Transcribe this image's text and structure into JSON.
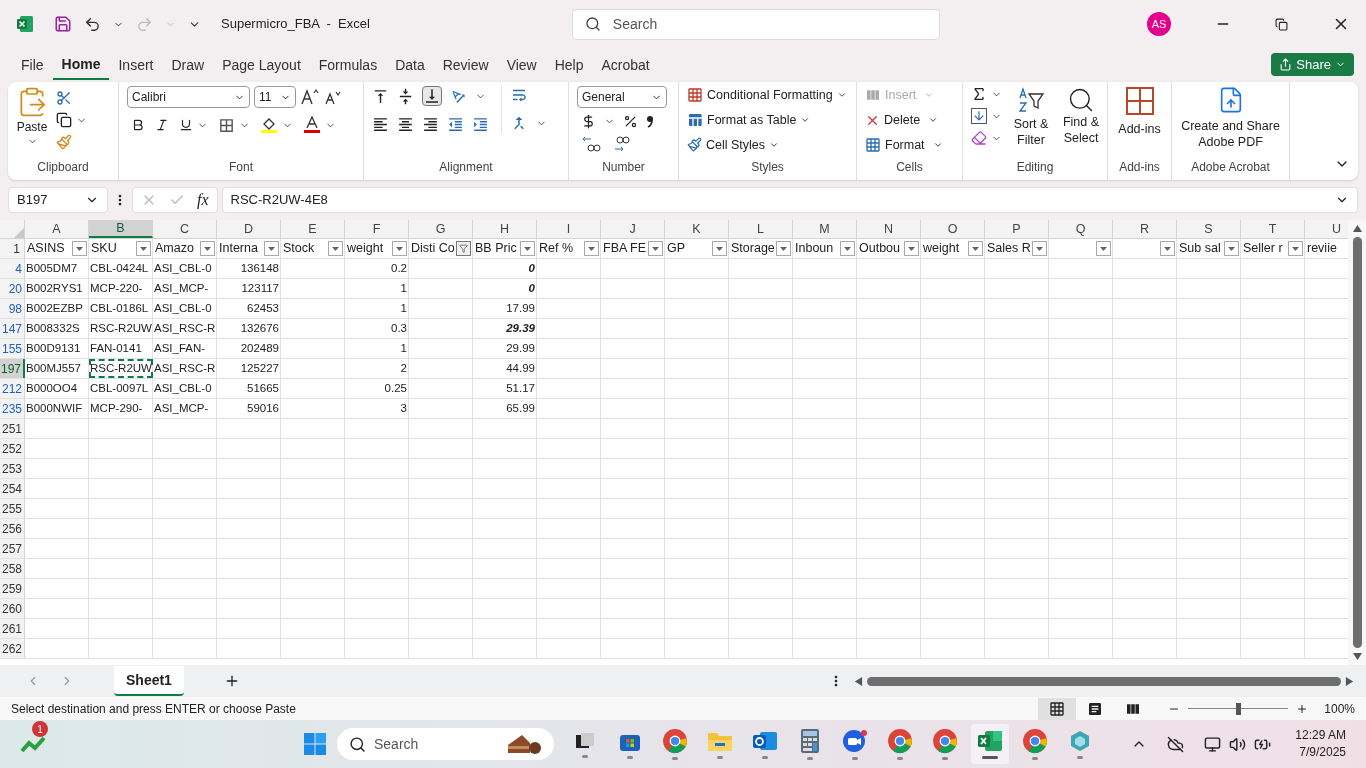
{
  "title_bar": {
    "title": "Supermicro_FBA  -  Excel",
    "search_placeholder": "Search",
    "avatar": "AS"
  },
  "menu_tabs": [
    {
      "label": "File",
      "selected": false
    },
    {
      "label": "Home",
      "selected": true
    },
    {
      "label": "Insert",
      "selected": false
    },
    {
      "label": "Draw",
      "selected": false
    },
    {
      "label": "Page Layout",
      "selected": false
    },
    {
      "label": "Formulas",
      "selected": false
    },
    {
      "label": "Data",
      "selected": false
    },
    {
      "label": "Review",
      "selected": false
    },
    {
      "label": "View",
      "selected": false
    },
    {
      "label": "Help",
      "selected": false
    },
    {
      "label": "Acrobat",
      "selected": false
    }
  ],
  "share_button": "Share",
  "ribbon": {
    "clipboard": {
      "label": "Clipboard",
      "paste": "Paste"
    },
    "font": {
      "label": "Font",
      "name": "Calibri",
      "size": "11"
    },
    "alignment": {
      "label": "Alignment"
    },
    "number": {
      "label": "Number",
      "format": "General"
    },
    "styles": {
      "label": "Styles",
      "items": [
        {
          "kind": "conditional",
          "label": "Conditional Formatting"
        },
        {
          "kind": "table",
          "label": "Format as Table"
        },
        {
          "kind": "cellstyles",
          "label": "Cell Styles"
        }
      ]
    },
    "cells": {
      "label": "Cells",
      "items": [
        {
          "kind": "insert",
          "label": "Insert",
          "disabled": true
        },
        {
          "kind": "delete",
          "label": "Delete",
          "disabled": false
        },
        {
          "kind": "format",
          "label": "Format",
          "disabled": false
        }
      ]
    },
    "editing": {
      "label": "Editing",
      "sort": "Sort & Filter",
      "find": "Find & Select"
    },
    "add_ins": {
      "label": "Add-ins",
      "button": "Add-ins"
    },
    "acrobat": {
      "label": "Adobe Acrobat",
      "button": "Create and Share Adobe PDF"
    }
  },
  "formula_bar": {
    "name_box": "B197",
    "function_symbol": "fx",
    "formula": "RSC-R2UW-4E8"
  },
  "sheet": {
    "header_row_number": "1",
    "columns": [
      {
        "letter": "A",
        "header": "ASINS",
        "kind": "text",
        "filter_button": true,
        "filtered": false,
        "selected": false
      },
      {
        "letter": "B",
        "header": "SKU",
        "kind": "text",
        "filter_button": true,
        "filtered": false,
        "selected": true
      },
      {
        "letter": "C",
        "header": "Amazo",
        "kind": "text",
        "filter_button": true,
        "filtered": false,
        "selected": false
      },
      {
        "letter": "D",
        "header": "Interna",
        "kind": "number",
        "filter_button": true,
        "filtered": false,
        "selected": false
      },
      {
        "letter": "E",
        "header": "Stock",
        "filter_button": true,
        "filtered": false,
        "selected": false
      },
      {
        "letter": "F",
        "header": "weight",
        "kind": "number",
        "filter_button": true,
        "filtered": false,
        "selected": false
      },
      {
        "letter": "G",
        "header": "Disti Co",
        "filter_button": true,
        "filtered": true,
        "selected": false
      },
      {
        "letter": "H",
        "header": "BB Pric",
        "kind": "number",
        "filter_button": true,
        "filtered": false,
        "selected": false
      },
      {
        "letter": "I",
        "header": "Ref %",
        "filter_button": true,
        "filtered": false,
        "selected": false
      },
      {
        "letter": "J",
        "header": "FBA FE",
        "filter_button": true,
        "filtered": false,
        "selected": false
      },
      {
        "letter": "K",
        "header": "GP",
        "filter_button": true,
        "filtered": false,
        "selected": false
      },
      {
        "letter": "L",
        "header": "Storage",
        "filter_button": true,
        "filtered": false,
        "selected": false
      },
      {
        "letter": "M",
        "header": "Inboun",
        "filter_button": true,
        "filtered": false,
        "selected": false
      },
      {
        "letter": "N",
        "header": "Outbou",
        "filter_button": true,
        "filtered": false,
        "selected": false
      },
      {
        "letter": "O",
        "header": "weight",
        "filter_button": true,
        "filtered": false,
        "selected": false
      },
      {
        "letter": "P",
        "header": "Sales R",
        "filter_button": true,
        "filtered": false,
        "selected": false
      },
      {
        "letter": "Q",
        "filter_button": true,
        "filtered": false,
        "selected": false
      },
      {
        "letter": "R",
        "filter_button": true,
        "filtered": false,
        "selected": false
      },
      {
        "letter": "S",
        "header": "Sub sal",
        "filter_button": true,
        "filtered": false,
        "selected": false
      },
      {
        "letter": "T",
        "header": "Seller r",
        "filter_button": true,
        "filtered": false,
        "selected": false
      },
      {
        "letter": "U",
        "header": "reviie",
        "filter_button": false,
        "selected": false
      }
    ],
    "rows": [
      {
        "number": "4",
        "selected": false,
        "cells": {
          "A": {
            "text": "B005DM7"
          },
          "B": {
            "text": "CBL-0424L"
          },
          "C": {
            "text": "ASI_CBL-0"
          },
          "D": {
            "text": "136148"
          },
          "F": {
            "text": "0.2"
          },
          "H": {
            "text": "0",
            "emphasized": true
          }
        }
      },
      {
        "number": "20",
        "selected": false,
        "cells": {
          "A": {
            "text": "B002RYS1"
          },
          "B": {
            "text": "MCP-220-"
          },
          "C": {
            "text": "ASI_MCP-"
          },
          "D": {
            "text": "123117"
          },
          "F": {
            "text": "1"
          },
          "H": {
            "text": "0",
            "emphasized": true
          }
        }
      },
      {
        "number": "98",
        "selected": false,
        "cells": {
          "A": {
            "text": "B002EZBP"
          },
          "B": {
            "text": "CBL-0186L"
          },
          "C": {
            "text": "ASI_CBL-0"
          },
          "D": {
            "text": "62453"
          },
          "F": {
            "text": "1"
          },
          "H": {
            "text": "17.99",
            "emphasized": false
          }
        }
      },
      {
        "number": "147",
        "selected": false,
        "cells": {
          "A": {
            "text": "B008332S"
          },
          "B": {
            "text": "RSC-R2UW"
          },
          "C": {
            "text": "ASI_RSC-R"
          },
          "D": {
            "text": "132676"
          },
          "F": {
            "text": "0.3"
          },
          "H": {
            "text": "29.39",
            "emphasized": true
          }
        }
      },
      {
        "number": "155",
        "selected": false,
        "cells": {
          "A": {
            "text": "B00D9131"
          },
          "B": {
            "text": "FAN-0141"
          },
          "C": {
            "text": "ASI_FAN-"
          },
          "D": {
            "text": "202489"
          },
          "F": {
            "text": "1"
          },
          "H": {
            "text": "29.99",
            "emphasized": false
          }
        }
      },
      {
        "number": "197",
        "selected": true,
        "cells": {
          "A": {
            "text": "B00MJ557"
          },
          "B": {
            "text": "RSC-R2UW"
          },
          "C": {
            "text": "ASI_RSC-R"
          },
          "D": {
            "text": "125227"
          },
          "F": {
            "text": "2"
          },
          "H": {
            "text": "44.99",
            "emphasized": false
          }
        }
      },
      {
        "number": "212",
        "selected": false,
        "cells": {
          "A": {
            "text": "B000OO4"
          },
          "B": {
            "text": "CBL-0097L"
          },
          "C": {
            "text": "ASI_CBL-0"
          },
          "D": {
            "text": "51665"
          },
          "F": {
            "text": "0.25"
          },
          "H": {
            "text": "51.17",
            "emphasized": false
          }
        }
      },
      {
        "number": "235",
        "selected": false,
        "cells": {
          "A": {
            "text": "B000NWIF"
          },
          "B": {
            "text": "MCP-290-"
          },
          "C": {
            "text": "ASI_MCP-"
          },
          "D": {
            "text": "59016"
          },
          "F": {
            "text": "3"
          },
          "H": {
            "text": "65.99",
            "emphasized": false
          }
        }
      },
      {
        "number": "251",
        "selected": false
      },
      {
        "number": "252",
        "selected": false
      },
      {
        "number": "253",
        "selected": false
      },
      {
        "number": "254",
        "selected": false
      },
      {
        "number": "255",
        "selected": false
      },
      {
        "number": "256",
        "selected": false
      },
      {
        "number": "257",
        "selected": false
      },
      {
        "number": "258",
        "selected": false
      },
      {
        "number": "259",
        "selected": false
      },
      {
        "number": "260",
        "selected": false
      },
      {
        "number": "261",
        "selected": false
      },
      {
        "number": "262",
        "selected": false
      }
    ]
  },
  "sheet_tabs": [
    {
      "label": "Sheet1",
      "selected": true
    }
  ],
  "status_bar": {
    "message": "Select destination and press ENTER or choose Paste",
    "zoom": "100%",
    "zoom_slider": {
      "level": 0.5
    },
    "views": [
      {
        "kind": "normal",
        "selected": true
      },
      {
        "kind": "page_layout",
        "selected": false
      },
      {
        "kind": "page_break",
        "selected": false
      }
    ]
  },
  "taskbar": {
    "widget_badge": "1",
    "search_placeholder": "Search",
    "time": "12:29 AM",
    "date": "7/9/2025",
    "apps": [
      {
        "kind": "task_view",
        "selected": false
      },
      {
        "kind": "store",
        "selected": false
      },
      {
        "kind": "chrome",
        "selected": false
      },
      {
        "kind": "explorer",
        "selected": false
      },
      {
        "kind": "outlook",
        "selected": false
      },
      {
        "kind": "calculator",
        "selected": false
      },
      {
        "kind": "zoom",
        "selected": false
      },
      {
        "kind": "chrome",
        "selected": false
      },
      {
        "kind": "chrome",
        "selected": false
      },
      {
        "kind": "excel",
        "selected": true
      },
      {
        "kind": "chrome",
        "selected": false
      },
      {
        "kind": "gem",
        "selected": false
      }
    ]
  }
}
